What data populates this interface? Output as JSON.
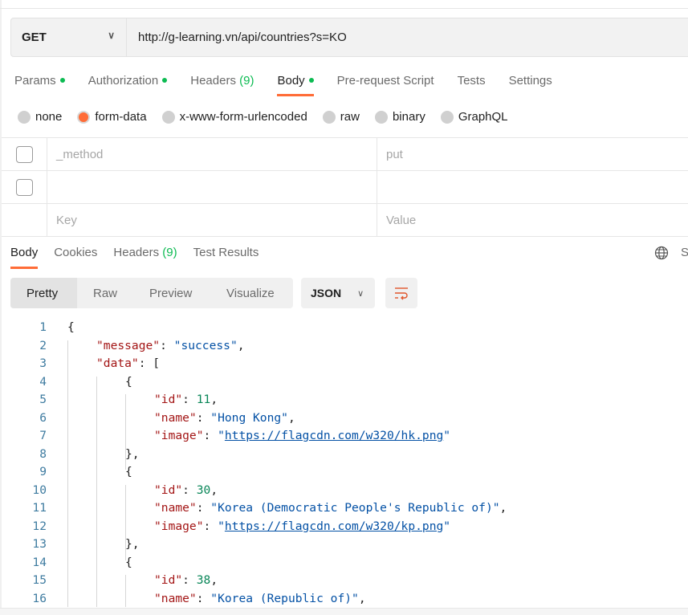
{
  "request": {
    "method": "GET",
    "url": "http://g-learning.vn/api/countries?s=KO"
  },
  "request_tabs": [
    {
      "label": "Params",
      "dot": true
    },
    {
      "label": "Authorization",
      "dot": true
    },
    {
      "label": "Headers",
      "count": "(9)"
    },
    {
      "label": "Body",
      "dot": true,
      "active": true
    },
    {
      "label": "Pre-request Script"
    },
    {
      "label": "Tests"
    },
    {
      "label": "Settings"
    }
  ],
  "body_types": [
    {
      "label": "none"
    },
    {
      "label": "form-data",
      "selected": true
    },
    {
      "label": "x-www-form-urlencoded"
    },
    {
      "label": "raw"
    },
    {
      "label": "binary"
    },
    {
      "label": "GraphQL"
    }
  ],
  "form_rows": [
    {
      "key": "_method",
      "value": "put"
    },
    {
      "key": "",
      "value": ""
    }
  ],
  "form_placeholder": {
    "key": "Key",
    "value": "Value"
  },
  "response_tabs": [
    {
      "label": "Body",
      "active": true
    },
    {
      "label": "Cookies"
    },
    {
      "label": "Headers",
      "count": "(9)"
    },
    {
      "label": "Test Results"
    }
  ],
  "response_right_label": "S",
  "view_modes": [
    "Pretty",
    "Raw",
    "Preview",
    "Visualize"
  ],
  "format": "JSON",
  "colors": {
    "accent": "#ff6c37",
    "green": "#0cbb52",
    "key": "#a31515",
    "string": "#0451a5",
    "number": "#098658"
  },
  "code_lines": [
    {
      "n": "1",
      "indent": 0,
      "tokens": [
        {
          "t": "{",
          "c": ""
        }
      ]
    },
    {
      "n": "2",
      "indent": 1,
      "tokens": [
        {
          "t": "\"message\"",
          "c": "key"
        },
        {
          "t": ": ",
          "c": ""
        },
        {
          "t": "\"success\"",
          "c": "str"
        },
        {
          "t": ",",
          "c": ""
        }
      ]
    },
    {
      "n": "3",
      "indent": 1,
      "tokens": [
        {
          "t": "\"data\"",
          "c": "key"
        },
        {
          "t": ": [",
          "c": ""
        }
      ]
    },
    {
      "n": "4",
      "indent": 2,
      "tokens": [
        {
          "t": "{",
          "c": ""
        }
      ]
    },
    {
      "n": "5",
      "indent": 3,
      "tokens": [
        {
          "t": "\"id\"",
          "c": "key"
        },
        {
          "t": ": ",
          "c": ""
        },
        {
          "t": "11",
          "c": "num"
        },
        {
          "t": ",",
          "c": ""
        }
      ]
    },
    {
      "n": "6",
      "indent": 3,
      "tokens": [
        {
          "t": "\"name\"",
          "c": "key"
        },
        {
          "t": ": ",
          "c": ""
        },
        {
          "t": "\"Hong Kong\"",
          "c": "str"
        },
        {
          "t": ",",
          "c": ""
        }
      ]
    },
    {
      "n": "7",
      "indent": 3,
      "tokens": [
        {
          "t": "\"image\"",
          "c": "key"
        },
        {
          "t": ": ",
          "c": ""
        },
        {
          "t": "\"",
          "c": "str"
        },
        {
          "t": "https://flagcdn.com/w320/hk.png",
          "c": "link"
        },
        {
          "t": "\"",
          "c": "str"
        }
      ]
    },
    {
      "n": "8",
      "indent": 2,
      "tokens": [
        {
          "t": "},",
          "c": ""
        }
      ]
    },
    {
      "n": "9",
      "indent": 2,
      "tokens": [
        {
          "t": "{",
          "c": ""
        }
      ]
    },
    {
      "n": "10",
      "indent": 3,
      "tokens": [
        {
          "t": "\"id\"",
          "c": "key"
        },
        {
          "t": ": ",
          "c": ""
        },
        {
          "t": "30",
          "c": "num"
        },
        {
          "t": ",",
          "c": ""
        }
      ]
    },
    {
      "n": "11",
      "indent": 3,
      "tokens": [
        {
          "t": "\"name\"",
          "c": "key"
        },
        {
          "t": ": ",
          "c": ""
        },
        {
          "t": "\"Korea (Democratic People's Republic of)\"",
          "c": "str"
        },
        {
          "t": ",",
          "c": ""
        }
      ]
    },
    {
      "n": "12",
      "indent": 3,
      "tokens": [
        {
          "t": "\"image\"",
          "c": "key"
        },
        {
          "t": ": ",
          "c": ""
        },
        {
          "t": "\"",
          "c": "str"
        },
        {
          "t": "https://flagcdn.com/w320/kp.png",
          "c": "link"
        },
        {
          "t": "\"",
          "c": "str"
        }
      ]
    },
    {
      "n": "13",
      "indent": 2,
      "tokens": [
        {
          "t": "},",
          "c": ""
        }
      ]
    },
    {
      "n": "14",
      "indent": 2,
      "tokens": [
        {
          "t": "{",
          "c": ""
        }
      ]
    },
    {
      "n": "15",
      "indent": 3,
      "tokens": [
        {
          "t": "\"id\"",
          "c": "key"
        },
        {
          "t": ": ",
          "c": ""
        },
        {
          "t": "38",
          "c": "num"
        },
        {
          "t": ",",
          "c": ""
        }
      ]
    },
    {
      "n": "16",
      "indent": 3,
      "tokens": [
        {
          "t": "\"name\"",
          "c": "key"
        },
        {
          "t": ": ",
          "c": ""
        },
        {
          "t": "\"Korea (Republic of)\"",
          "c": "str"
        },
        {
          "t": ",",
          "c": ""
        }
      ]
    }
  ]
}
